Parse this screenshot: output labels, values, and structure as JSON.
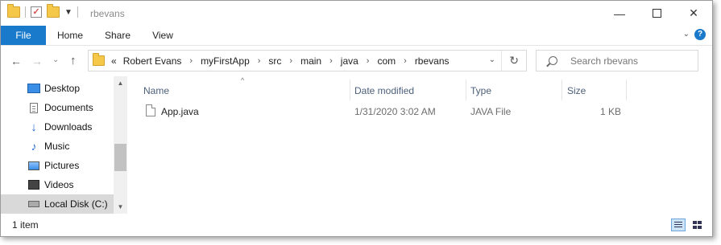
{
  "window": {
    "title": "rbevans",
    "controls": {
      "minimize": "—",
      "maximize": "",
      "close": "✕"
    }
  },
  "ribbon": {
    "tabs": [
      "File",
      "Home",
      "Share",
      "View"
    ]
  },
  "nav": {
    "back": "←",
    "forward": "→",
    "recent": "⌄",
    "up": "↑",
    "overflow": "«",
    "breadcrumbs": [
      "Robert Evans",
      "myFirstApp",
      "src",
      "main",
      "java",
      "com",
      "rbevans"
    ],
    "separator": "›",
    "refresh": "↻",
    "search_placeholder": "Search rbevans"
  },
  "sidebar": {
    "items": [
      {
        "label": "Desktop",
        "icon": "desktop-icon"
      },
      {
        "label": "Documents",
        "icon": "documents-icon"
      },
      {
        "label": "Downloads",
        "icon": "downloads-icon"
      },
      {
        "label": "Music",
        "icon": "music-icon"
      },
      {
        "label": "Pictures",
        "icon": "pictures-icon"
      },
      {
        "label": "Videos",
        "icon": "videos-icon"
      },
      {
        "label": "Local Disk (C:)",
        "icon": "local-disk-icon",
        "selected": true
      }
    ]
  },
  "columns": {
    "name": "Name",
    "date": "Date modified",
    "type": "Type",
    "size": "Size"
  },
  "files": [
    {
      "name": "App.java",
      "date": "1/31/2020 3:02 AM",
      "type": "JAVA File",
      "size": "1 KB"
    }
  ],
  "status": {
    "count": "1 item"
  },
  "colors": {
    "accent": "#1979ca",
    "selection": "#d9d9d9",
    "header_text": "#4c607a"
  }
}
